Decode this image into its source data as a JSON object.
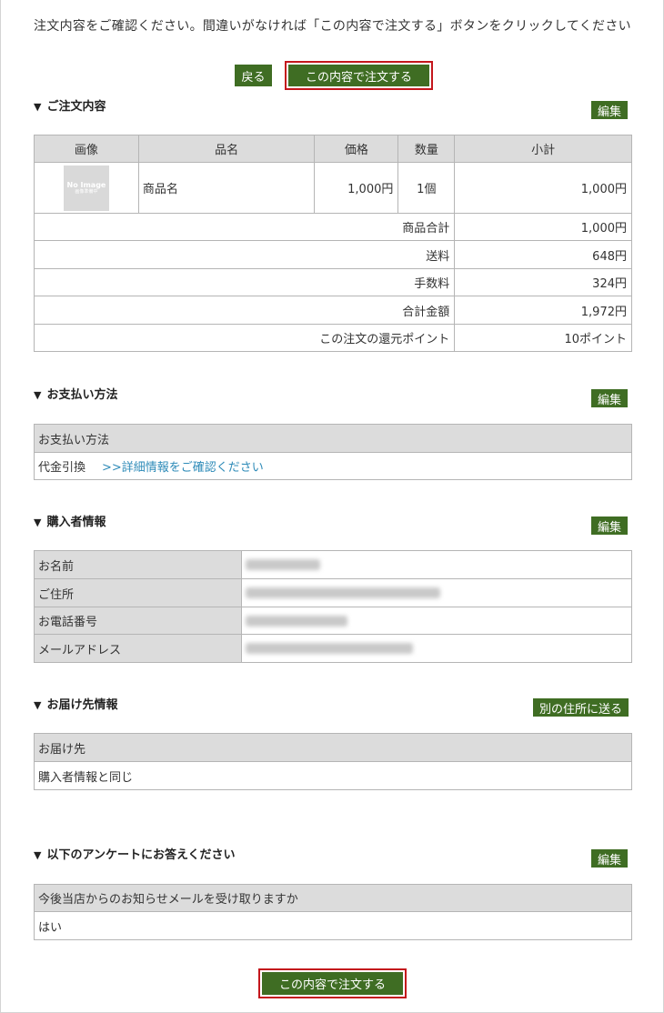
{
  "intro": "注文内容をご確認ください。間違いがなければ「この内容で注文する」ボタンをクリックしてください",
  "buttons": {
    "back": "戻る",
    "order": "この内容で注文する",
    "edit": "編集",
    "other_address": "別の住所に送る"
  },
  "order": {
    "title": "ご注文内容",
    "headers": [
      "画像",
      "品名",
      "価格",
      "数量",
      "小計"
    ],
    "item": {
      "no_image_line1": "No Image",
      "no_image_line2": "画像準備中",
      "name": "商品名",
      "price": "1,000円",
      "qty": "1個",
      "subtotal": "1,000円"
    },
    "summary": [
      {
        "label": "商品合計",
        "value": "1,000円"
      },
      {
        "label": "送料",
        "value": "648円"
      },
      {
        "label": "手数料",
        "value": "324円"
      },
      {
        "label": "合計金額",
        "value": "1,972円"
      },
      {
        "label": "この注文の還元ポイント",
        "value": "10ポイント"
      }
    ]
  },
  "payment": {
    "title": "お支払い方法",
    "header": "お支払い方法",
    "method": "代金引換",
    "detail_link": ">>詳細情報をご確認ください"
  },
  "buyer": {
    "title": "購入者情報",
    "rows": [
      {
        "label": "お名前"
      },
      {
        "label": "ご住所"
      },
      {
        "label": "お電話番号"
      },
      {
        "label": "メールアドレス"
      }
    ]
  },
  "delivery": {
    "title": "お届け先情報",
    "header": "お届け先",
    "value": "購入者情報と同じ"
  },
  "survey": {
    "title": "以下のアンケートにお答えください",
    "question": "今後当店からのお知らせメールを受け取りますか",
    "answer": "はい"
  },
  "colors": {
    "button_green": "#3f6d23",
    "outline_red": "#c4161c",
    "header_gray": "#dcdcdc",
    "link_blue": "#2e8bb8"
  }
}
